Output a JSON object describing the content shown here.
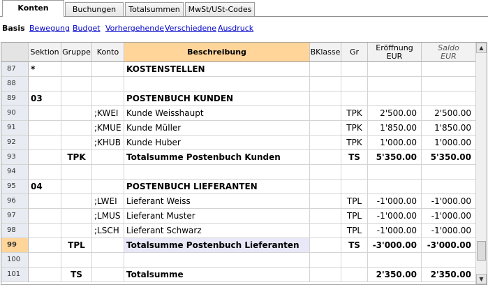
{
  "tabs": [
    "Konten",
    "Buchungen",
    "Totalsummen",
    "MwSt/USt-Codes"
  ],
  "subnav": {
    "basis": "Basis",
    "links": [
      "Bewegung",
      "Budget",
      "Vorhergehende",
      "Verschiedene",
      "Ausdruck"
    ]
  },
  "columns": {
    "sektion": "Sektion",
    "gruppe": "Gruppe",
    "konto": "Konto",
    "beschreibung": "Beschreibung",
    "bklasse": "BKlasse",
    "gr": "Gr",
    "eroeffnung": "Eröffnung",
    "eroeffnung_unit": "EUR",
    "saldo": "Saldo",
    "saldo_unit": "EUR"
  },
  "rows": [
    {
      "n": "87",
      "sektion": "*",
      "gruppe": "",
      "konto": "",
      "beschreibung": "KOSTENSTELLEN",
      "gr": "",
      "eroeffnung": "",
      "saldo": ""
    },
    {
      "n": "88",
      "sektion": "",
      "gruppe": "",
      "konto": "",
      "beschreibung": "",
      "gr": "",
      "eroeffnung": "",
      "saldo": ""
    },
    {
      "n": "89",
      "sektion": "03",
      "gruppe": "",
      "konto": "",
      "beschreibung": "POSTENBUCH KUNDEN",
      "gr": "",
      "eroeffnung": "",
      "saldo": ""
    },
    {
      "n": "90",
      "sektion": "",
      "gruppe": "",
      "konto": ";KWEI",
      "beschreibung": "Kunde Weisshaupt",
      "gr": "TPK",
      "eroeffnung": "2'500.00",
      "saldo": "2'500.00"
    },
    {
      "n": "91",
      "sektion": "",
      "gruppe": "",
      "konto": ";KMUE",
      "beschreibung": "Kunde Müller",
      "gr": "TPK",
      "eroeffnung": "1'850.00",
      "saldo": "1'850.00"
    },
    {
      "n": "92",
      "sektion": "",
      "gruppe": "",
      "konto": ";KHUB",
      "beschreibung": "Kunde Huber",
      "gr": "TPK",
      "eroeffnung": "1'000.00",
      "saldo": "1'000.00"
    },
    {
      "n": "93",
      "sektion": "",
      "gruppe": "TPK",
      "konto": "",
      "beschreibung": "Totalsumme Postenbuch Kunden",
      "gr": "TS",
      "eroeffnung": "5'350.00",
      "saldo": "5'350.00"
    },
    {
      "n": "94",
      "sektion": "",
      "gruppe": "",
      "konto": "",
      "beschreibung": "",
      "gr": "",
      "eroeffnung": "",
      "saldo": ""
    },
    {
      "n": "95",
      "sektion": "04",
      "gruppe": "",
      "konto": "",
      "beschreibung": "POSTENBUCH LIEFERANTEN",
      "gr": "",
      "eroeffnung": "",
      "saldo": ""
    },
    {
      "n": "96",
      "sektion": "",
      "gruppe": "",
      "konto": ";LWEI",
      "beschreibung": "Lieferant Weiss",
      "gr": "TPL",
      "eroeffnung": "-1'000.00",
      "saldo": "-1'000.00"
    },
    {
      "n": "97",
      "sektion": "",
      "gruppe": "",
      "konto": ";LMUS",
      "beschreibung": "Lieferant Muster",
      "gr": "TPL",
      "eroeffnung": "-1'000.00",
      "saldo": "-1'000.00"
    },
    {
      "n": "98",
      "sektion": "",
      "gruppe": "",
      "konto": ";LSCH",
      "beschreibung": "Lieferant Schwarz",
      "gr": "TPL",
      "eroeffnung": "-1'000.00",
      "saldo": "-1'000.00"
    },
    {
      "n": "99",
      "sektion": "",
      "gruppe": "TPL",
      "konto": "",
      "beschreibung": "Totalsumme Postenbuch Lieferanten",
      "gr": "TS",
      "eroeffnung": "-3'000.00",
      "saldo": "-3'000.00"
    },
    {
      "n": "100",
      "sektion": "",
      "gruppe": "",
      "konto": "",
      "beschreibung": "",
      "gr": "",
      "eroeffnung": "",
      "saldo": ""
    },
    {
      "n": "101",
      "sektion": "",
      "gruppe": "TS",
      "konto": "",
      "beschreibung": "Totalsumme",
      "gr": "",
      "eroeffnung": "2'350.00",
      "saldo": "2'350.00"
    }
  ],
  "current_row": "99",
  "colors": {
    "selected_header": "#ffd59a",
    "link": "#0000cc",
    "row_highlight": "#e8e8f8"
  }
}
